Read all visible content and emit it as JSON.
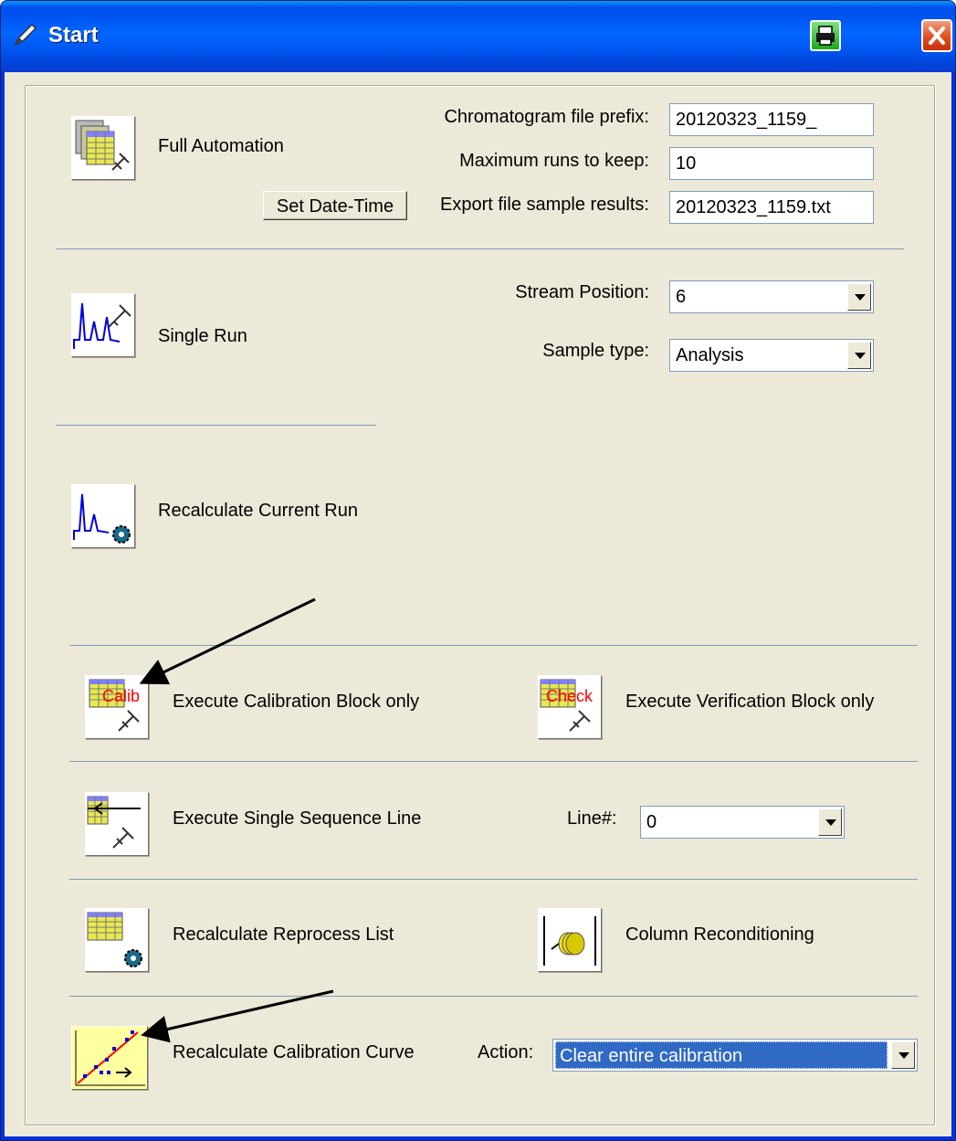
{
  "window": {
    "title": "Start"
  },
  "full_automation": {
    "label": "Full Automation",
    "set_datetime_label": "Set Date-Time",
    "prefix_label": "Chromatogram file prefix:",
    "prefix_value": "20120323_1159_",
    "max_runs_label": "Maximum runs to keep:",
    "max_runs_value": "10",
    "export_label": "Export file sample results:",
    "export_value": "20120323_1159.txt"
  },
  "single_run": {
    "label": "Single Run",
    "stream_label": "Stream Position:",
    "stream_value": "6",
    "sample_type_label": "Sample type:",
    "sample_type_value": "Analysis"
  },
  "recalc_current": {
    "label": "Recalculate Current Run"
  },
  "calibration_block": {
    "label": "Execute Calibration Block only",
    "icon_text": "Calib"
  },
  "verification_block": {
    "label": "Execute Verification Block only",
    "icon_text": "Check"
  },
  "single_sequence": {
    "label": "Execute Single Sequence Line",
    "line_label": "Line#:",
    "line_value": "0"
  },
  "reprocess": {
    "label": "Recalculate Reprocess List"
  },
  "column_recond": {
    "label": "Column Reconditioning"
  },
  "calib_curve": {
    "label": "Recalculate Calibration Curve",
    "action_label": "Action:",
    "action_value": "Clear entire calibration"
  },
  "colors": {
    "titlebar": "#0054e3",
    "face": "#ece9d8",
    "separator": "#7f9db9",
    "selection": "#316ac5",
    "calib_text": "#ff0000"
  }
}
